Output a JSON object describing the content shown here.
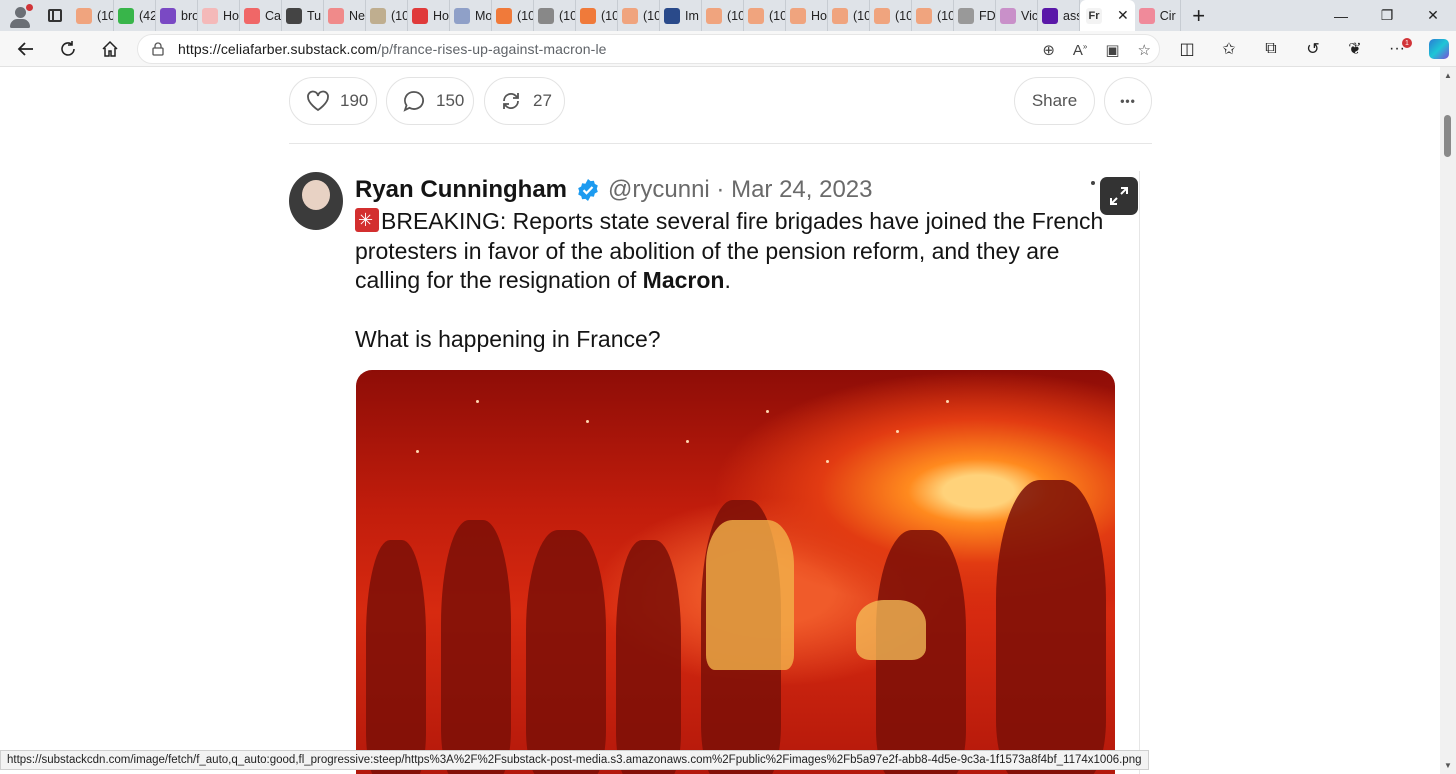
{
  "browser": {
    "tabs": [
      {
        "label": "(10",
        "color": "#f0a47e"
      },
      {
        "label": "(42",
        "color": "#38b54a"
      },
      {
        "label": "bro",
        "color": "#7a49c4"
      },
      {
        "label": "Ho",
        "color": "#f4b9b9"
      },
      {
        "label": "Ca",
        "color": "#f06767"
      },
      {
        "label": "Tu",
        "color": "#444444"
      },
      {
        "label": "Ne",
        "color": "#f08a8a"
      },
      {
        "label": "(10",
        "color": "#bfae8f"
      },
      {
        "label": "Ho",
        "color": "#e03a3a"
      },
      {
        "label": "Mo",
        "color": "#8fa0c8"
      },
      {
        "label": "(10",
        "color": "#f07a3a"
      },
      {
        "label": "(10",
        "color": "#888888"
      },
      {
        "label": "(10",
        "color": "#f07a3a"
      },
      {
        "label": "(10",
        "color": "#f0a47e"
      },
      {
        "label": "Im",
        "color": "#2a4a8a"
      },
      {
        "label": "(10",
        "color": "#f0a47e"
      },
      {
        "label": "(10",
        "color": "#f0a47e"
      },
      {
        "label": "Ho",
        "color": "#f0a47e"
      },
      {
        "label": "(10",
        "color": "#f0a47e"
      },
      {
        "label": "(10",
        "color": "#f0a47e"
      },
      {
        "label": "(10",
        "color": "#f0a47e"
      },
      {
        "label": "FD",
        "color": "#999999"
      },
      {
        "label": "Vic",
        "color": "#c990c9"
      },
      {
        "label": "ass",
        "color": "#5a18a8"
      }
    ],
    "active_tab": {
      "label": "Fr",
      "close": "✕"
    },
    "after_tab": {
      "label": "Cir",
      "color": "#f08a9a"
    },
    "new_tab": "+",
    "url": {
      "host": "https://celiafarber.substack.com",
      "path": "/p/france-rises-up-against-macron-le"
    }
  },
  "post_actions": {
    "likes": "190",
    "comments": "150",
    "restacks": "27",
    "share_label": "Share",
    "more_label": "•••"
  },
  "tweet": {
    "author_name": "Ryan Cunningham",
    "handle_date": "@rycunni · Mar 24, 2023",
    "line1": "BREAKING:  Reports state several fire brigades have joined the French",
    "line2": "protesters in favor of the abolition of the pension reform, and they are",
    "line3_prefix": "calling for the resignation of ",
    "line3_bold": "Macron",
    "line3_suffix": ".",
    "line4": "What is happening in France?"
  },
  "status_bar": {
    "text": "https://substackcdn.com/image/fetch/f_auto,q_auto:good,fl_progressive:steep/https%3A%2F%2Fsubstack-post-media.s3.amazonaws.com%2Fpublic%2Fimages%2Fb5a97e2f-abb8-4d5e-9c3a-1f1573a8f4bf_1174x1006.png"
  },
  "colors": {
    "verified_badge": "#1d9bf0",
    "tab_strip": "#dfe3e8",
    "media_red": "#c21d0c"
  }
}
